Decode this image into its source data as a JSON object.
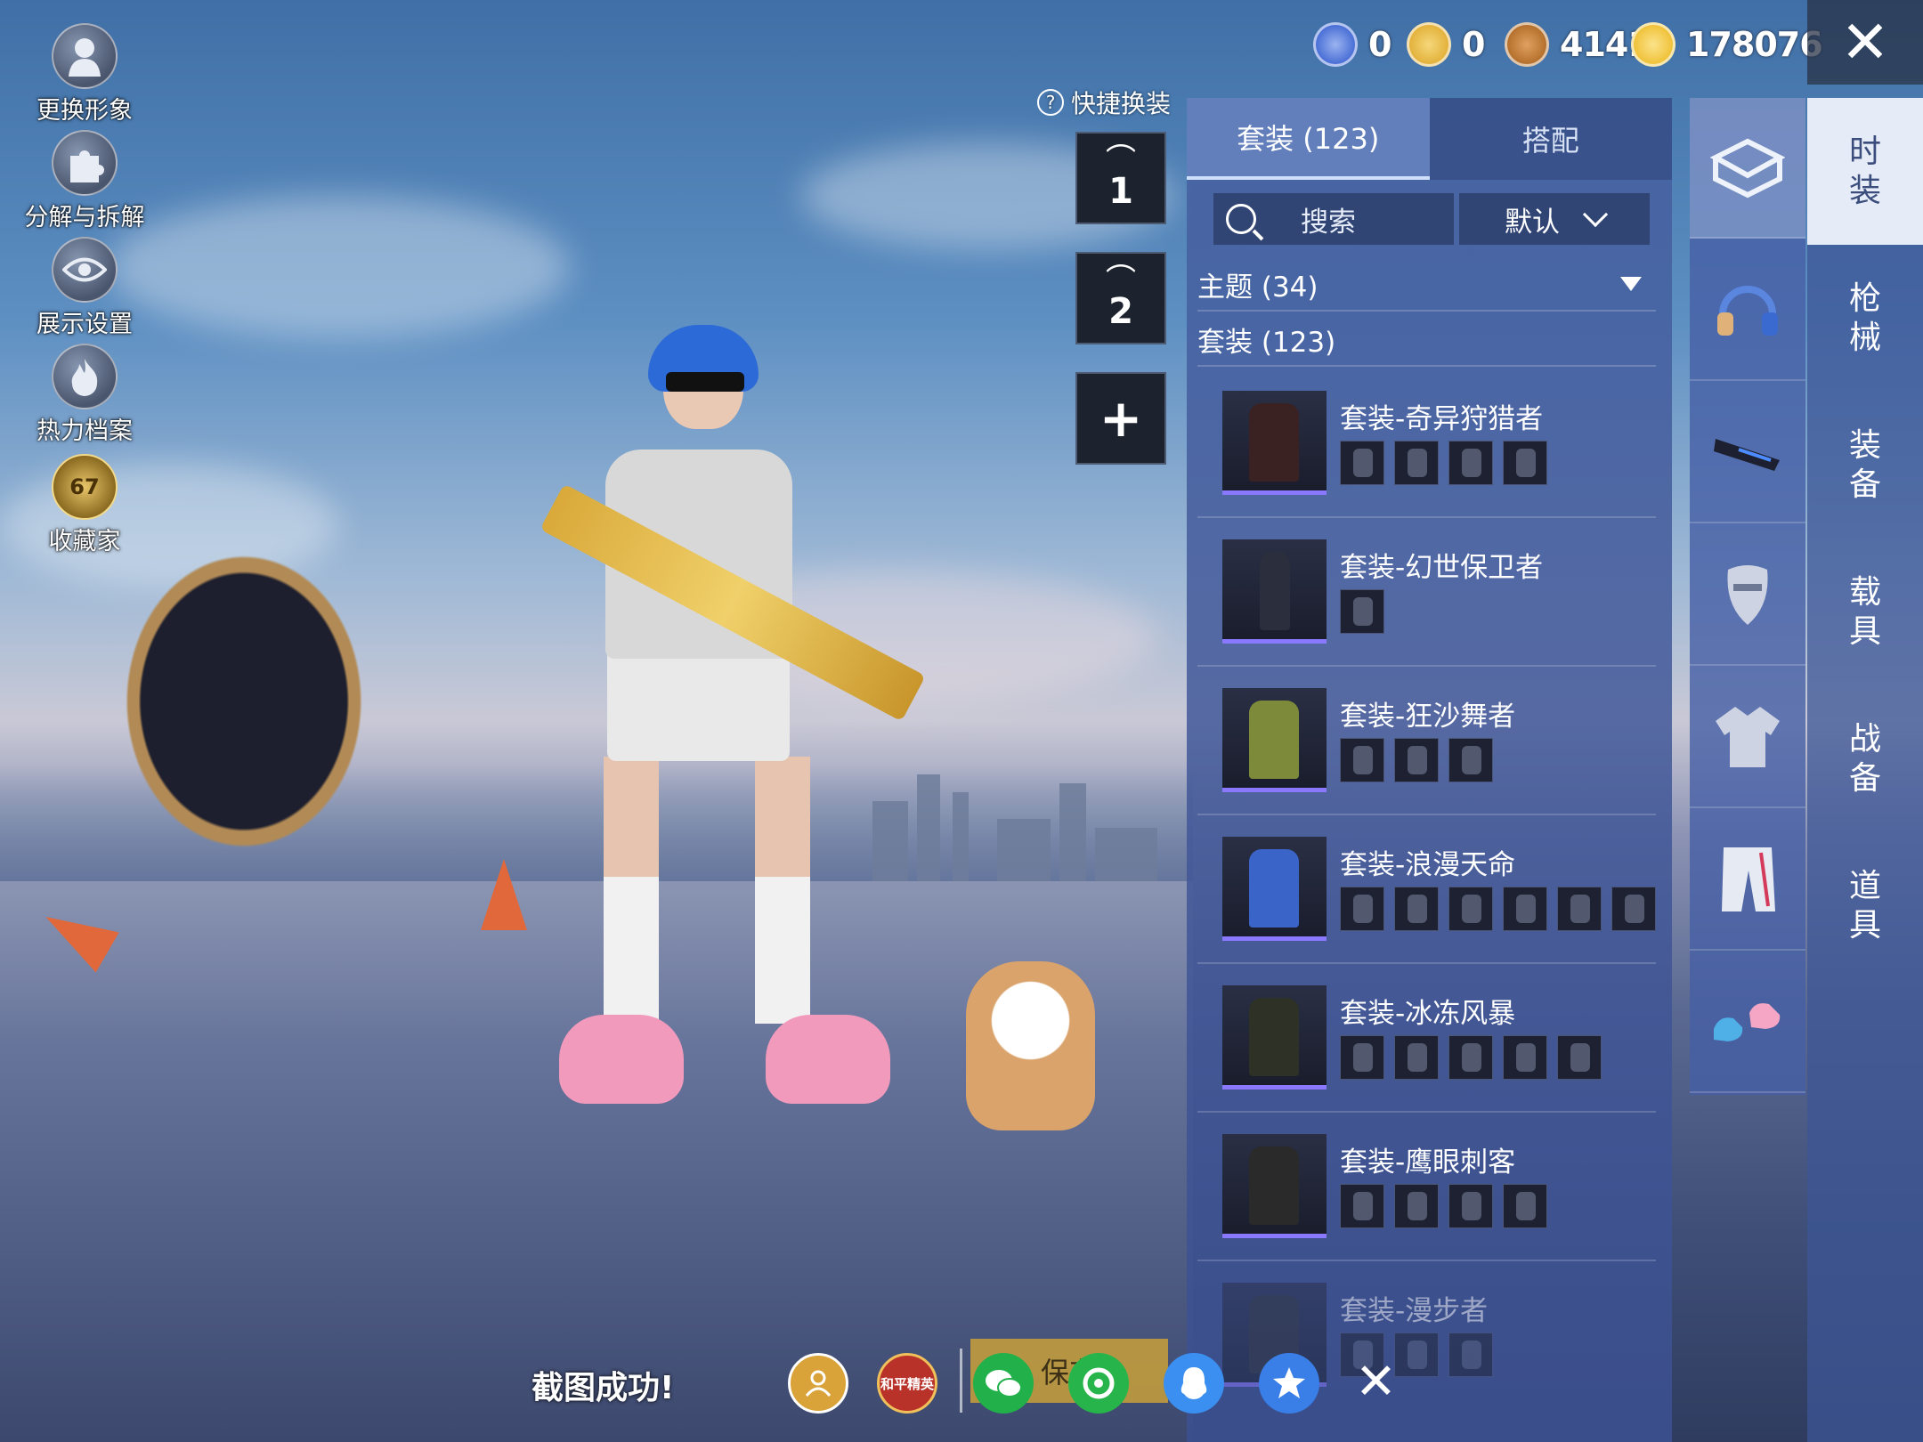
{
  "left_menu": [
    {
      "label": "更换形象",
      "icon": "person-icon"
    },
    {
      "label": "分解与拆解",
      "icon": "puzzle-icon"
    },
    {
      "label": "展示设置",
      "icon": "eye-icon"
    },
    {
      "label": "热力档案",
      "icon": "flame-icon"
    },
    {
      "label": "收藏家",
      "icon": "collector-badge-icon",
      "badge": "67"
    }
  ],
  "resources": [
    {
      "value": "0",
      "icon": "blue-coin-icon",
      "color": "#4a6fd6"
    },
    {
      "value": "0",
      "icon": "gold-triangle-coin-icon",
      "color": "#e3b23c"
    },
    {
      "value": "4141",
      "icon": "bronze-coin-icon",
      "color": "#b5702c"
    },
    {
      "value": "178076",
      "icon": "lightning-coin-icon",
      "color": "#f0c23a"
    }
  ],
  "close_symbol": "✕",
  "quick_change": {
    "label": "快捷换装",
    "help": "?"
  },
  "slots": [
    "1",
    "2",
    "+"
  ],
  "tabs": [
    {
      "label": "套装 (123)",
      "active": true
    },
    {
      "label": "搭配",
      "active": false
    }
  ],
  "search": {
    "label": "搜索"
  },
  "sort": {
    "selected": "默认"
  },
  "theme_row": {
    "label": "主题 (34)"
  },
  "suit_header": {
    "label": "套装 (123)"
  },
  "outfits": [
    {
      "name": "套装-奇异狩猎者",
      "parts": 4
    },
    {
      "name": "套装-幻世保卫者",
      "parts": 1
    },
    {
      "name": "套装-狂沙舞者",
      "parts": 3
    },
    {
      "name": "套装-浪漫天命",
      "parts": 6
    },
    {
      "name": "套装-冰冻风暴",
      "parts": 5
    },
    {
      "name": "套装-鹰眼刺客",
      "parts": 4
    },
    {
      "name": "套装-漫步者",
      "parts": 3
    }
  ],
  "categories": [
    {
      "icon": "wardrobe-box-icon",
      "active": true
    },
    {
      "icon": "headphones-icon",
      "active": false
    },
    {
      "icon": "visor-icon",
      "active": false
    },
    {
      "icon": "mask-icon",
      "active": false
    },
    {
      "icon": "jacket-icon",
      "active": false
    },
    {
      "icon": "pants-icon",
      "active": false
    },
    {
      "icon": "shoes-icon",
      "active": false
    }
  ],
  "vertical_tabs": [
    {
      "label": "时装",
      "active": true
    },
    {
      "label": "枪械",
      "active": false
    },
    {
      "label": "装备",
      "active": false
    },
    {
      "label": "载具",
      "active": false
    },
    {
      "label": "战备",
      "active": false
    },
    {
      "label": "道具",
      "active": false
    }
  ],
  "bottom": {
    "toast": "截图成功!",
    "save_label": "保存",
    "share": [
      {
        "icon": "friends-icon",
        "color": "#d9a33a"
      },
      {
        "icon": "game-logo-icon",
        "color": "#b8322a",
        "text": "和平精英"
      },
      {
        "icon": "wechat-icon",
        "color": "#22b04a"
      },
      {
        "icon": "moments-icon",
        "color": "#27b54b"
      },
      {
        "icon": "qq-icon",
        "color": "#3a8ff0"
      },
      {
        "icon": "qzone-icon",
        "color": "#3a7fe8"
      }
    ],
    "close_symbol": "✕"
  }
}
